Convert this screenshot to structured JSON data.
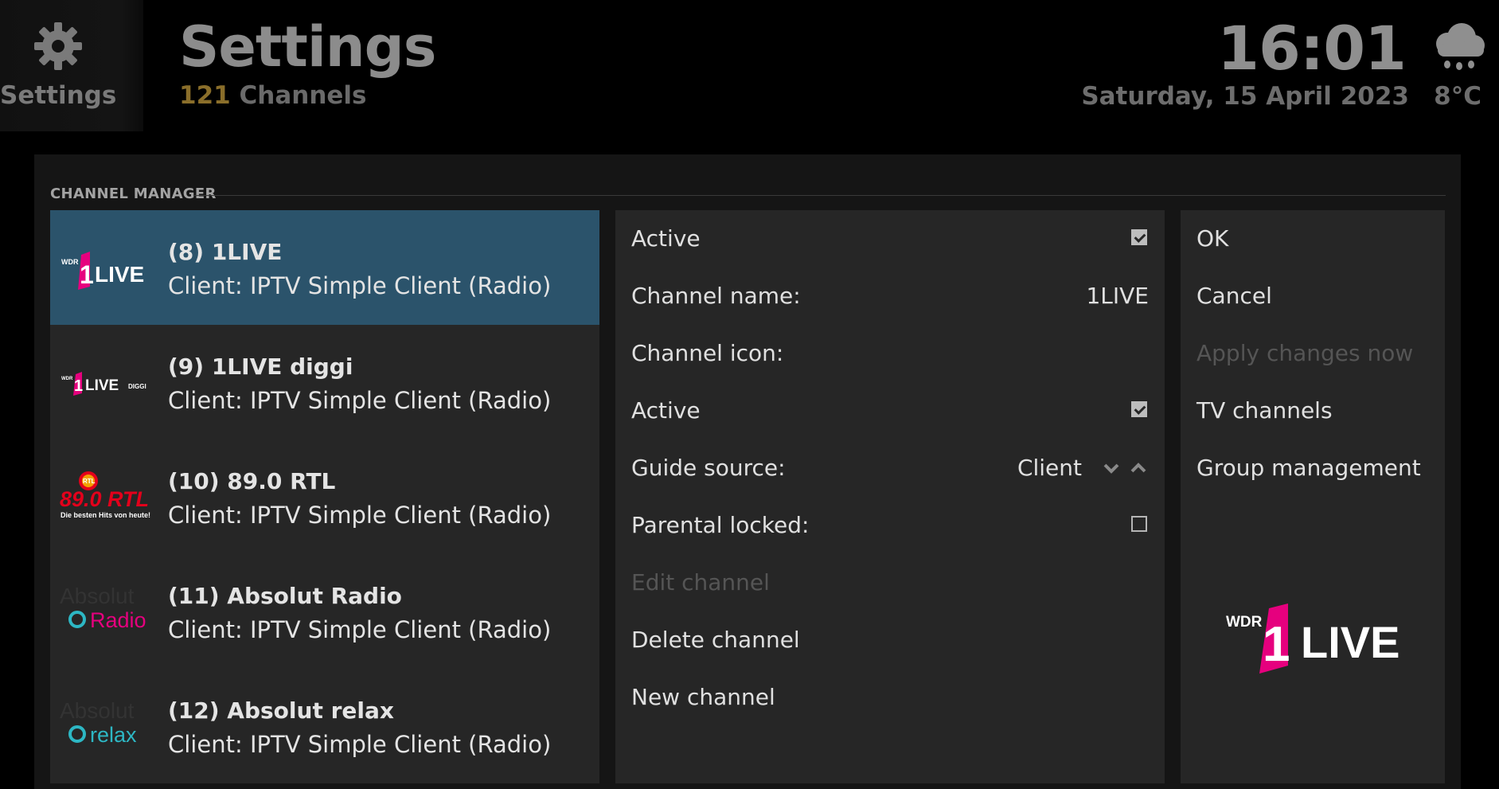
{
  "header": {
    "icon_label": "Settings",
    "title": "Settings",
    "channel_count": "121",
    "channel_count_label": "Channels",
    "time": "16:01",
    "date": "Saturday, 15 April 2023",
    "temperature": "8°C",
    "weather_icon": "rain-cloud-icon"
  },
  "section_title": "CHANNEL MANAGER",
  "channels": [
    {
      "name": "(8) 1LIVE",
      "client": "Client: IPTV Simple Client (Radio)",
      "logo": "1live-logo",
      "logo_text": "WDR 1LIVE",
      "selected": true
    },
    {
      "name": "(9) 1LIVE diggi",
      "client": "Client: IPTV Simple Client (Radio)",
      "logo": "1live-diggi-logo",
      "logo_text": "WDR 1LIVE DIGGI",
      "selected": false
    },
    {
      "name": "(10) 89.0 RTL",
      "client": "Client: IPTV Simple Client (Radio)",
      "logo": "rtl-890-logo",
      "logo_text": "89.0 RTL Die besten Hits von heute!",
      "selected": false
    },
    {
      "name": "(11) Absolut Radio",
      "client": "Client: IPTV Simple Client (Radio)",
      "logo": "absolut-radio-logo",
      "logo_text": "Absolut Radio",
      "selected": false
    },
    {
      "name": "(12) Absolut relax",
      "client": "Client: IPTV Simple Client (Radio)",
      "logo": "absolut-relax-logo",
      "logo_text": "Absolut relax",
      "selected": false
    }
  ],
  "details": {
    "active_label": "Active",
    "active_checked": true,
    "channel_name_label": "Channel name:",
    "channel_name_value": "1LIVE",
    "channel_icon_label": "Channel icon:",
    "active2_label": "Active",
    "active2_checked": true,
    "guide_source_label": "Guide source:",
    "guide_source_value": "Client",
    "parental_locked_label": "Parental locked:",
    "parental_locked_checked": false,
    "edit_channel_label": "Edit channel",
    "delete_channel_label": "Delete channel",
    "new_channel_label": "New channel"
  },
  "actions": {
    "ok": "OK",
    "cancel": "Cancel",
    "apply": "Apply changes now",
    "tv_channels": "TV channels",
    "group_management": "Group management"
  },
  "colors": {
    "selected_row": "#2b536b",
    "panel": "#262626",
    "accent_pink": "#e6007e",
    "count_gold": "#8a6e2a"
  }
}
